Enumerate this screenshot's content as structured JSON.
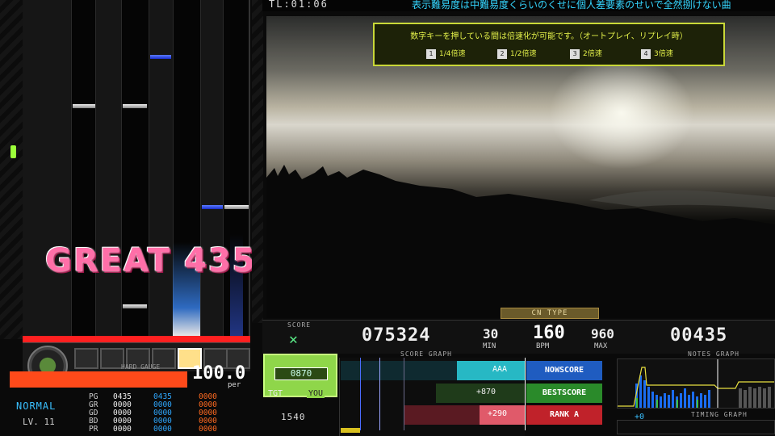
{
  "top": {
    "time_label": "TL:01:06",
    "ticker": "表示難易度は中難易度くらいのくせに個人差要素のせいで全然捌けない曲"
  },
  "tip": {
    "message": "数字キーを押している間は倍速化が可能です。（オートプレイ、リプレイ時）",
    "speeds": [
      {
        "key": "1",
        "label": "1/4倍速"
      },
      {
        "key": "2",
        "label": "1/2倍速"
      },
      {
        "key": "3",
        "label": "2倍速"
      },
      {
        "key": "4",
        "label": "3倍速"
      }
    ],
    "accent_color": "#e4f14a"
  },
  "playfield": {
    "judge_text": "GREAT 435"
  },
  "cn_type_label": "CN TYPE",
  "gauge": {
    "label": "HARD GAUGE",
    "value": "100.0",
    "unit": "per",
    "fill_fraction": 1.0,
    "color": "#ff4a1a"
  },
  "player": {
    "mode": "NORMAL",
    "level": "LV. 11"
  },
  "judges": [
    {
      "label": "PG",
      "v1": "0435",
      "v2": "0435",
      "v3": "0000"
    },
    {
      "label": "GR",
      "v1": "0000",
      "v2": "0000",
      "v3": "0000"
    },
    {
      "label": "GD",
      "v1": "0000",
      "v2": "0000",
      "v3": "0000"
    },
    {
      "label": "BD",
      "v1": "0000",
      "v2": "0000",
      "v3": "0000"
    },
    {
      "label": "PR",
      "v1": "0000",
      "v2": "0000",
      "v3": "0000"
    }
  ],
  "score_strip": {
    "score_caption": "SCORE",
    "score": "075324",
    "min": "30",
    "min_label": "MIN",
    "bpm": "160",
    "bpm_label": "BPM",
    "max": "960",
    "max_label": "MAX",
    "combo": "00435",
    "icon": "close-x-icon"
  },
  "score_graph": {
    "caption": "SCORE GRAPH",
    "diff_value": "0870",
    "tgt_label": "TGT",
    "you_label": "YOU",
    "tgt_score": "1540",
    "aaa_label": "AAA",
    "best_diff": "+870",
    "rank_diff": "+290",
    "buttons": [
      {
        "label": "NOWSCORE",
        "color": "#1f5cc0"
      },
      {
        "label": "BESTSCORE",
        "color": "#2a8a2a"
      },
      {
        "label": "RANK A",
        "color": "#c0222a"
      }
    ]
  },
  "notes_graph": {
    "caption": "NOTES GRAPH"
  },
  "timing_graph": {
    "caption": "TIMING GRAPH",
    "value": "+0"
  }
}
